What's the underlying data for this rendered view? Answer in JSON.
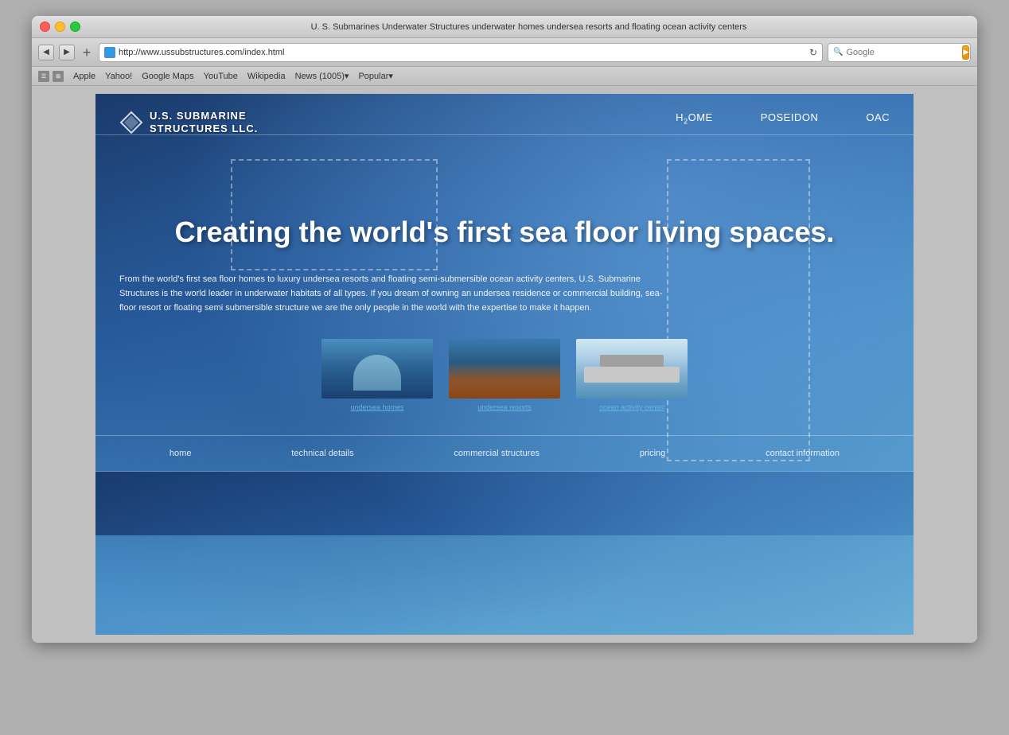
{
  "window": {
    "title": "U. S. Submarines Underwater Structures underwater homes undersea resorts and floating ocean activity centers"
  },
  "toolbar": {
    "back_label": "◀",
    "forward_label": "▶",
    "add_label": "+",
    "url": "http://www.ussubstructures.com/index.html",
    "refresh_label": "↻",
    "search_placeholder": "Google",
    "search_label": "🔍"
  },
  "bookmarks": {
    "items": [
      {
        "label": "Apple"
      },
      {
        "label": "Yahoo!"
      },
      {
        "label": "Google Maps"
      },
      {
        "label": "YouTube"
      },
      {
        "label": "Wikipedia"
      },
      {
        "label": "News (1005)▾"
      },
      {
        "label": "Popular▾"
      }
    ]
  },
  "site": {
    "logo_line1": "U.S. SUBMARINE",
    "logo_line2": "STRUCTURES LLC.",
    "nav": [
      {
        "label": "H₂OME",
        "id": "h2ome"
      },
      {
        "label": "POSEIDON",
        "id": "poseidon"
      },
      {
        "label": "OAC",
        "id": "oac"
      }
    ],
    "hero_heading": "Creating the world's first sea floor living spaces.",
    "hero_body": "From the world's first sea floor homes to luxury undersea resorts and floating semi-submersible ocean activity centers, U.S. Submarine Structures is the world leader in underwater habitats of all types. If you dream of owning an undersea residence or commercial building, sea-floor resort or floating semi submersible structure we are the only people in the world with the expertise to make it happen.",
    "cards": [
      {
        "label": "undersea homes",
        "type": "homes"
      },
      {
        "label": "undersea resorts",
        "type": "resorts"
      },
      {
        "label": "ocean activity center",
        "type": "oac"
      }
    ],
    "footer_nav": [
      {
        "label": "home"
      },
      {
        "label": "technical details"
      },
      {
        "label": "commercial structures"
      },
      {
        "label": "pricing"
      },
      {
        "label": "contact information"
      }
    ]
  }
}
